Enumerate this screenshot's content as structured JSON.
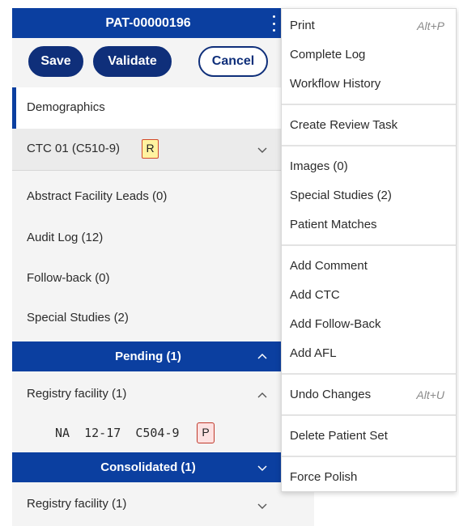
{
  "header": {
    "patient_id": "PAT-00000196"
  },
  "actions": {
    "save": "Save",
    "validate": "Validate",
    "cancel": "Cancel"
  },
  "nav": {
    "demographics": "Demographics",
    "ctc": {
      "label": "CTC 01 (C510-9)",
      "badge": "R"
    },
    "abstract_facility_leads": "Abstract Facility Leads (0)",
    "audit_log": "Audit Log (12)",
    "follow_back": "Follow-back (0)",
    "special_studies": "Special Studies (2)"
  },
  "pending": {
    "title": "Pending (1)",
    "registry_facility": "Registry facility (1)",
    "case": {
      "text": "NA  12-17  C504-9",
      "badge": "P"
    }
  },
  "consolidated": {
    "title": "Consolidated (1)",
    "registry_facility": "Registry facility (1)"
  },
  "menu": {
    "print": "Print",
    "print_shortcut": "Alt+P",
    "complete_log": "Complete Log",
    "workflow_history": "Workflow History",
    "create_review_task": "Create Review Task",
    "images": "Images (0)",
    "special_studies": "Special Studies (2)",
    "patient_matches": "Patient Matches",
    "add_comment": "Add Comment",
    "add_ctc": "Add CTC",
    "add_follow_back": "Add Follow-Back",
    "add_afl": "Add AFL",
    "undo_changes": "Undo Changes",
    "undo_shortcut": "Alt+U",
    "delete_patient_set": "Delete Patient Set",
    "force_polish": "Force Polish"
  },
  "colors": {
    "header_blue": "#0b3fa0",
    "button_navy": "#0f2f7a",
    "badge_r_fill": "#fff3a0",
    "badge_p_fill": "#fde1e1"
  },
  "icons": {
    "kebab": "kebab-menu-icon",
    "chevron_down": "chevron-down-icon",
    "chevron_up": "chevron-up-icon"
  }
}
